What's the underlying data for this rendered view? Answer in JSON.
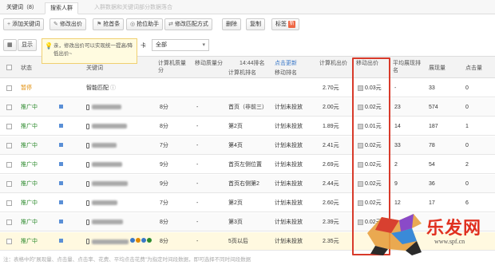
{
  "tabs": [
    {
      "label": "关键词（8）"
    },
    {
      "label": "搜索人群"
    },
    {
      "label": "入群数据和关键词部分数据落合"
    }
  ],
  "toolbar": {
    "add_keyword": "添加关键词",
    "modify_bid": "修改出价",
    "grab_top": "抢首条",
    "grab_position": "抢位助手",
    "modify_match": "修改匹配方式",
    "delete": "删除",
    "copy": "复制",
    "tag": "标签",
    "tag_badge": "新"
  },
  "filter": {
    "label_left": "显示",
    "select_value": "全部",
    "select_label": "卡"
  },
  "tooltip": {
    "text": "亲，修改出价可以实现统一提高/降低出价~"
  },
  "table": {
    "headers": {
      "status": "状态",
      "keyword": "关键词",
      "pc_quality": "计算机质量分",
      "mobile_quality": "移动质量分",
      "time": "14:44排名",
      "refresh": "点击更新",
      "pc_rank": "计算机排名",
      "mobile_rank": "移动排名",
      "pc_bid": "计算机出价",
      "mobile_bid": "移动出价",
      "avg_rank": "平均展现排名",
      "impressions": "展现量",
      "clicks": "点击量"
    },
    "rows": [
      {
        "status": "暂停",
        "status_color": "#e08a00",
        "keyword": "智能匹配",
        "pc_quality": "",
        "mobile_quality": "",
        "pc_rank": "",
        "mobile_rank": "",
        "pc_bid": "2.70元",
        "mobile_bid": "0.03元",
        "avg_rank": "-",
        "impressions": "33",
        "clicks": "0"
      },
      {
        "status": "推广中",
        "status_color": "#2e8b2e",
        "keyword": "",
        "pc_quality": "8分",
        "mobile_quality": "-",
        "pc_rank": "首页（非前三）",
        "mobile_rank": "计划未投放",
        "pc_bid": "2.00元",
        "mobile_bid": "0.02元",
        "avg_rank": "23",
        "impressions": "574",
        "clicks": "0"
      },
      {
        "status": "推广中",
        "status_color": "#2e8b2e",
        "keyword": "",
        "pc_quality": "8分",
        "mobile_quality": "-",
        "pc_rank": "第2页",
        "mobile_rank": "计划未投放",
        "pc_bid": "1.89元",
        "mobile_bid": "0.01元",
        "avg_rank": "14",
        "impressions": "187",
        "clicks": "1"
      },
      {
        "status": "推广中",
        "status_color": "#2e8b2e",
        "keyword": "",
        "pc_quality": "7分",
        "mobile_quality": "-",
        "pc_rank": "第4页",
        "mobile_rank": "计划未投放",
        "pc_bid": "2.41元",
        "mobile_bid": "0.02元",
        "avg_rank": "33",
        "impressions": "78",
        "clicks": "0"
      },
      {
        "status": "推广中",
        "status_color": "#2e8b2e",
        "keyword": "",
        "pc_quality": "9分",
        "mobile_quality": "-",
        "pc_rank": "首页左侧位置",
        "mobile_rank": "计划未投放",
        "pc_bid": "2.69元",
        "mobile_bid": "0.02元",
        "avg_rank": "2",
        "impressions": "54",
        "clicks": "2"
      },
      {
        "status": "推广中",
        "status_color": "#2e8b2e",
        "keyword": "",
        "pc_quality": "9分",
        "mobile_quality": "-",
        "pc_rank": "首页右侧第2",
        "mobile_rank": "计划未投放",
        "pc_bid": "2.44元",
        "mobile_bid": "0.02元",
        "avg_rank": "9",
        "impressions": "36",
        "clicks": "0"
      },
      {
        "status": "推广中",
        "status_color": "#2e8b2e",
        "keyword": "",
        "pc_quality": "7分",
        "mobile_quality": "-",
        "pc_rank": "第2页",
        "mobile_rank": "计划未投放",
        "pc_bid": "2.60元",
        "mobile_bid": "0.02元",
        "avg_rank": "12",
        "impressions": "17",
        "clicks": "6"
      },
      {
        "status": "推广中",
        "status_color": "#2e8b2e",
        "keyword": "",
        "pc_quality": "8分",
        "mobile_quality": "-",
        "pc_rank": "第3页",
        "mobile_rank": "计划未投放",
        "pc_bid": "2.39元",
        "mobile_bid": "0.02元",
        "avg_rank": "",
        "impressions": "",
        "clicks": ""
      },
      {
        "status": "推广中",
        "status_color": "#2e8b2e",
        "keyword": "",
        "pc_quality": "8分",
        "mobile_quality": "-",
        "pc_rank": "5页以后",
        "mobile_rank": "计划未投放",
        "pc_bid": "2.35元",
        "mobile_bid": "",
        "avg_rank": "",
        "impressions": "",
        "clicks": ""
      }
    ]
  },
  "footer": {
    "note": "注：表格中的\"展现量、点击量、点击率、花费、平均点击花费\"为指定时间段数据，即可选择不同时间段数据"
  },
  "watermark": {
    "title": "乐发网",
    "url": "www.spf.cn"
  },
  "colors": {
    "highlight_box": "#d83a2a",
    "status_active": "#2e8b2e",
    "status_paused": "#e08a00",
    "link": "#3a78c8"
  }
}
